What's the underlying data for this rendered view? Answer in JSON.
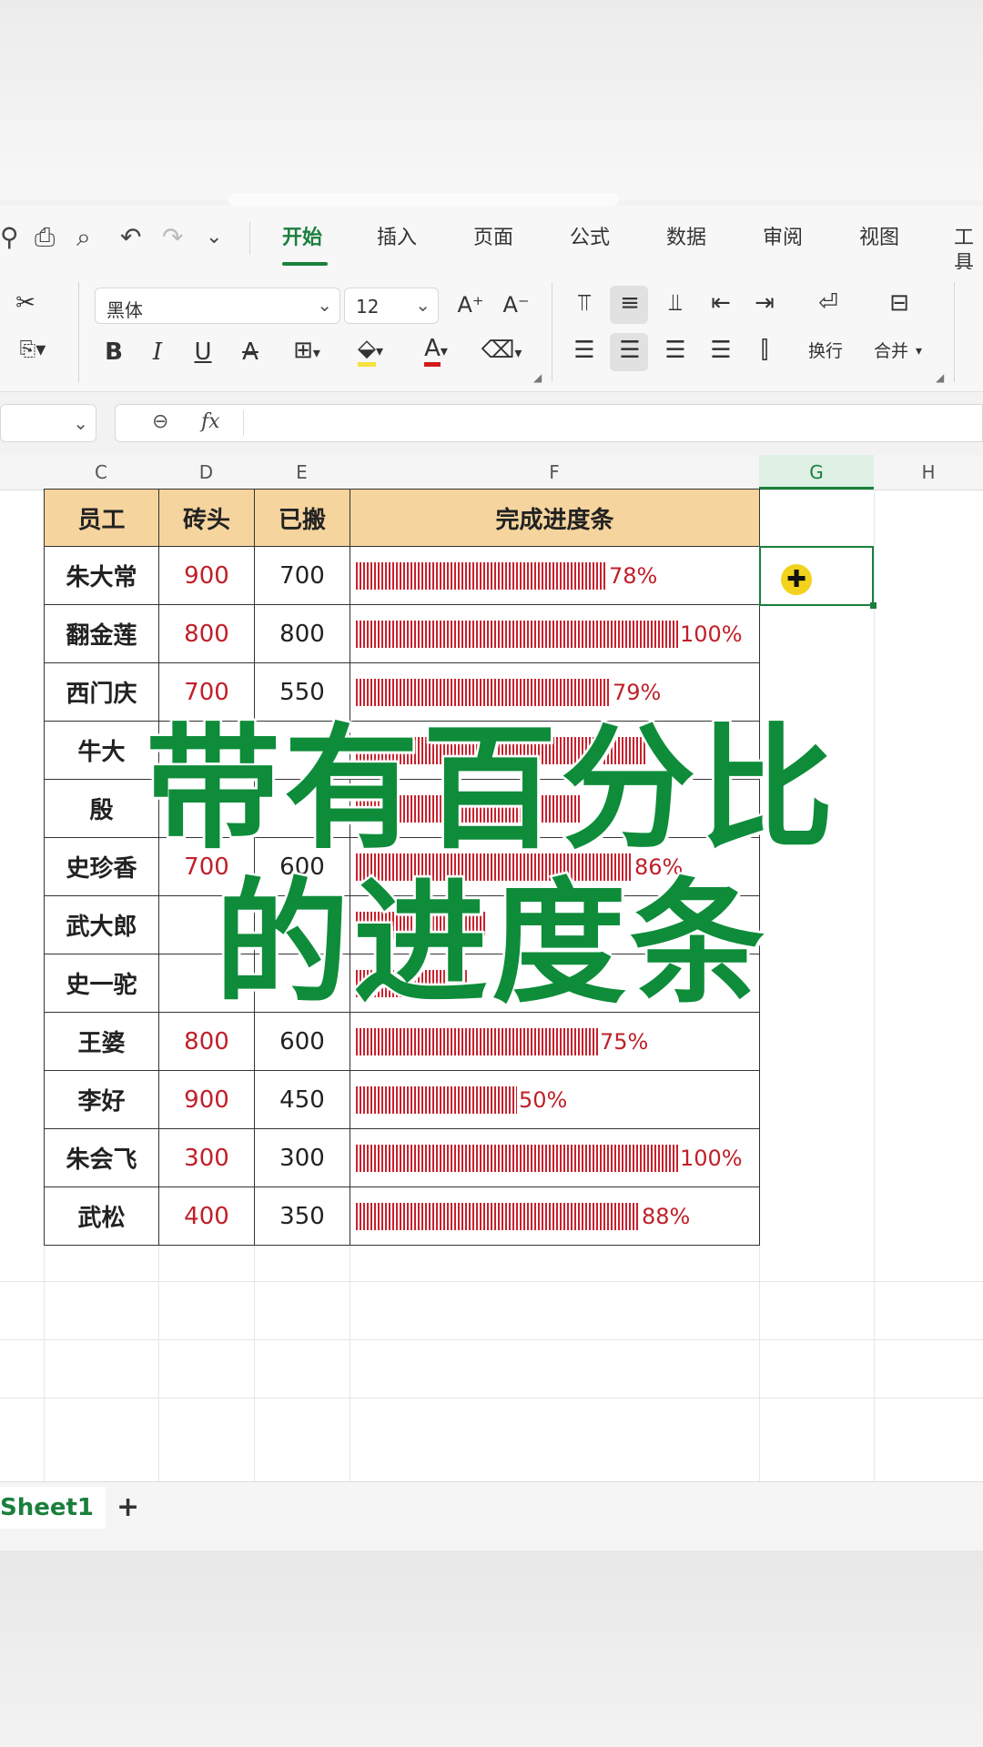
{
  "tabs": [
    "开始",
    "插入",
    "页面",
    "公式",
    "数据",
    "审阅",
    "视图",
    "工具"
  ],
  "active_tab": "开始",
  "ribbon": {
    "font_name": "黑体",
    "font_size": "12",
    "bold": "B",
    "italic": "I",
    "underline": "U",
    "strike": "A",
    "grow_font": "A⁺",
    "shrink_font": "A⁻",
    "wrap_label": "换行",
    "merge_label": "合并"
  },
  "formula_bar": {
    "fx": "fx",
    "value": ""
  },
  "columns": [
    "C",
    "D",
    "E",
    "F",
    "G",
    "H"
  ],
  "table": {
    "headers": [
      "员工",
      "砖头",
      "已搬",
      "完成进度条"
    ],
    "rows": [
      {
        "name": "朱大常",
        "bricks": "900",
        "moved": "700",
        "bar": "||||||||||||||||||||||||||||||||||||||||||",
        "pct": "78%",
        "value": 0.78
      },
      {
        "name": "翻金莲",
        "bricks": "800",
        "moved": "800",
        "bar": "|||||||||||||||||||||||||||||||||||||||||||||||||||||||",
        "pct": "100%",
        "value": 1.0
      },
      {
        "name": "西门庆",
        "bricks": "700",
        "moved": "550",
        "bar": "|||||||||||||||||||||||||||||||||||||||||||",
        "pct": "79%",
        "value": 0.79
      },
      {
        "name": "牛大",
        "bricks": "",
        "moved": "",
        "bar": "",
        "pct": "",
        "value": 0.9
      },
      {
        "name": "殷",
        "bricks": "",
        "moved": "",
        "bar": "",
        "pct": "",
        "value": 0.7
      },
      {
        "name": "史珍香",
        "bricks": "700",
        "moved": "600",
        "bar": "",
        "pct": "86%",
        "value": 0.86
      },
      {
        "name": "武大郎",
        "bricks": "",
        "moved": "",
        "bar": "",
        "pct": "",
        "value": 0.4
      },
      {
        "name": "史一驼",
        "bricks": "",
        "moved": "",
        "bar": "",
        "pct": "",
        "value": 0.35
      },
      {
        "name": "王婆",
        "bricks": "800",
        "moved": "600",
        "bar": "",
        "pct": "75%",
        "value": 0.75
      },
      {
        "name": "李好",
        "bricks": "900",
        "moved": "450",
        "bar": "",
        "pct": "50%",
        "value": 0.5
      },
      {
        "name": "朱会飞",
        "bricks": "300",
        "moved": "300",
        "bar": "",
        "pct": "100%",
        "value": 1.0
      },
      {
        "name": "武松",
        "bricks": "400",
        "moved": "350",
        "bar": "",
        "pct": "88%",
        "value": 0.88
      }
    ]
  },
  "overlay": {
    "line1": "带有百分比",
    "line2": "的进度条"
  },
  "sheet_tabs": {
    "active": "Sheet1",
    "add": "+"
  },
  "colors": {
    "accent": "#1a7f3c",
    "header_fill": "#f5d49e",
    "bar": "#c8202c",
    "overlay_text": "#0e8c3a"
  }
}
